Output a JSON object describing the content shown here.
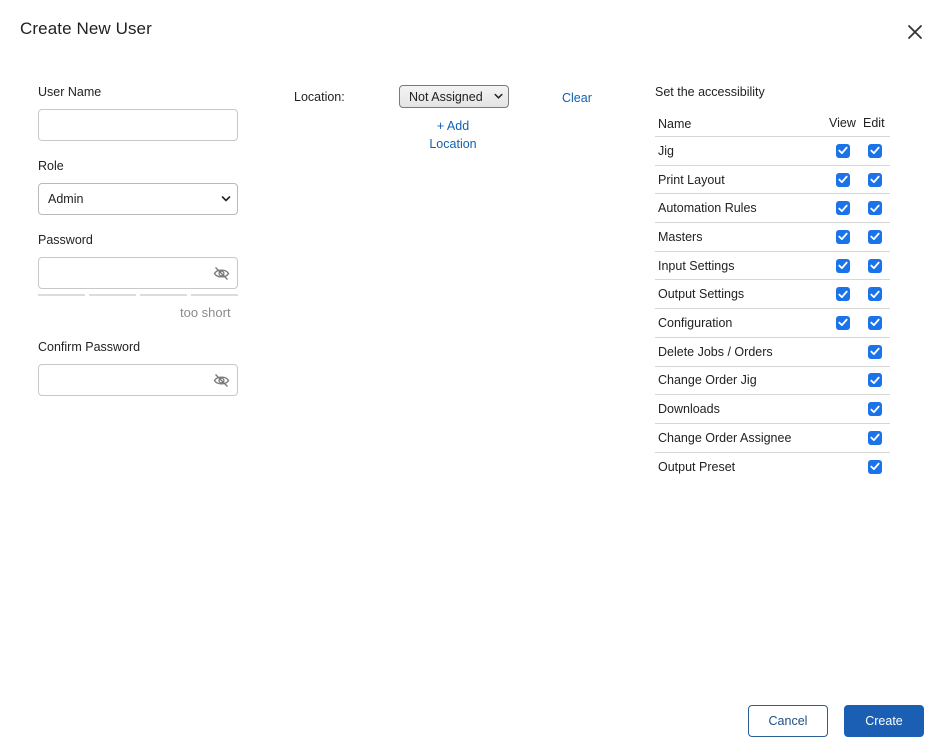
{
  "dialog": {
    "title": "Create New User",
    "close_icon": "close-icon"
  },
  "form": {
    "user_name": {
      "label": "User Name",
      "value": "",
      "placeholder": ""
    },
    "role": {
      "label": "Role",
      "value": "Admin"
    },
    "password": {
      "label": "Password",
      "value": "",
      "strength_text": "too short",
      "strength_level": 0
    },
    "confirm_password": {
      "label": "Confirm Password",
      "value": ""
    }
  },
  "location": {
    "label": "Location:",
    "selected": "Not Assigned",
    "add_link": "+ Add Location",
    "clear_link": "Clear"
  },
  "accessibility": {
    "title": "Set the accessibility",
    "columns": {
      "name": "Name",
      "view": "View",
      "edit": "Edit"
    },
    "rows": [
      {
        "name": "Jig",
        "view": true,
        "edit": true
      },
      {
        "name": "Print Layout",
        "view": true,
        "edit": true
      },
      {
        "name": "Automation Rules",
        "view": true,
        "edit": true
      },
      {
        "name": "Masters",
        "view": true,
        "edit": true
      },
      {
        "name": "Input Settings",
        "view": true,
        "edit": true
      },
      {
        "name": "Output Settings",
        "view": true,
        "edit": true
      },
      {
        "name": "Configuration",
        "view": true,
        "edit": true
      },
      {
        "name": "Delete Jobs / Orders",
        "view": null,
        "edit": true
      },
      {
        "name": "Change Order Jig",
        "view": null,
        "edit": true
      },
      {
        "name": "Downloads",
        "view": null,
        "edit": true
      },
      {
        "name": "Change Order Assignee",
        "view": null,
        "edit": true
      },
      {
        "name": "Output Preset",
        "view": null,
        "edit": true
      }
    ]
  },
  "footer": {
    "cancel_label": "Cancel",
    "create_label": "Create"
  },
  "colors": {
    "primary": "#1a5fb4",
    "checkbox": "#1a73e8",
    "link": "#1261b0"
  }
}
